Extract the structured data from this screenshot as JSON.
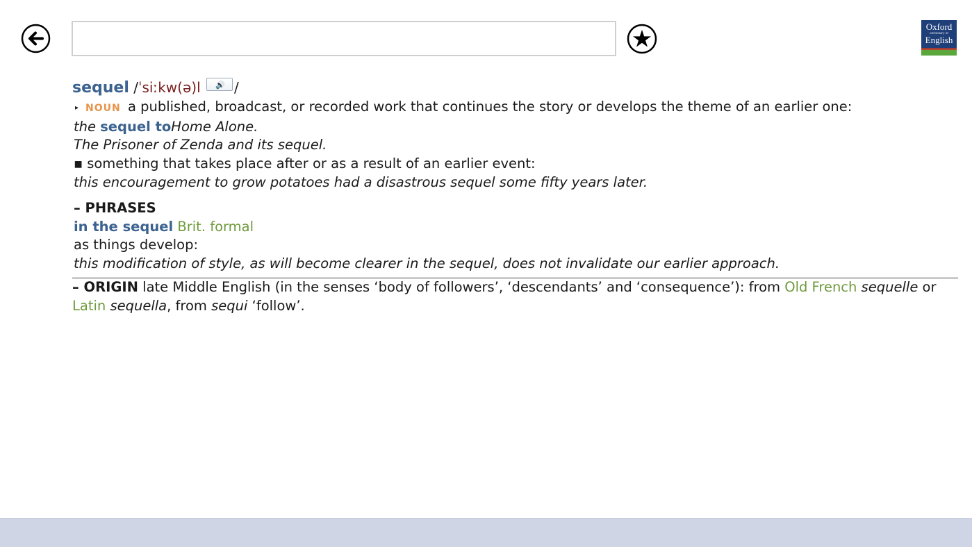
{
  "toolbar": {
    "back_icon": "arrow-left-circle-icon",
    "search_value": "",
    "search_placeholder": "",
    "favorite_icon": "star-circle-icon",
    "logo": {
      "line1": "Oxford",
      "line2": "Dictionary of",
      "line3": "English"
    }
  },
  "entry": {
    "headword": "sequel",
    "pron_open": "/",
    "pronunciation": "ˈsiːkw(ə)l",
    "pron_close": "/",
    "audio_icon": "speaker-icon",
    "sense1": {
      "marker": "▸",
      "pos": "NOUN",
      "definition": "a published, broadcast, or recorded work that continues the story or develops the theme of an earlier one:",
      "examples": [
        {
          "pre": "the ",
          "collocation": "sequel to",
          "post": "Home Alone."
        },
        {
          "text": "The Prisoner of Zenda and its sequel."
        }
      ]
    },
    "sense2": {
      "marker": "▪",
      "definition": "something that takes place after or as a result of an earlier event:",
      "example": "this encouragement to grow potatoes had a disastrous sequel some fifty years later."
    },
    "phrases": {
      "heading": "– PHRASES",
      "phrase": "in the sequel",
      "register": "Brit. formal",
      "definition": "as things develop:",
      "example": "this modification of style, as will become clearer in the sequel, does not invalidate our earlier approach."
    },
    "origin": {
      "heading": "– ORIGIN",
      "text1": " late Middle English (in the senses ‘body of followers’, ‘descendants’ and ‘consequence’): from ",
      "lang1": "Old French",
      "word1": "sequelle",
      "text2": " or ",
      "lang2": "Latin",
      "word2": "sequella",
      "text3": ", from ",
      "word3": "sequi",
      "text4": " ‘follow’."
    }
  }
}
